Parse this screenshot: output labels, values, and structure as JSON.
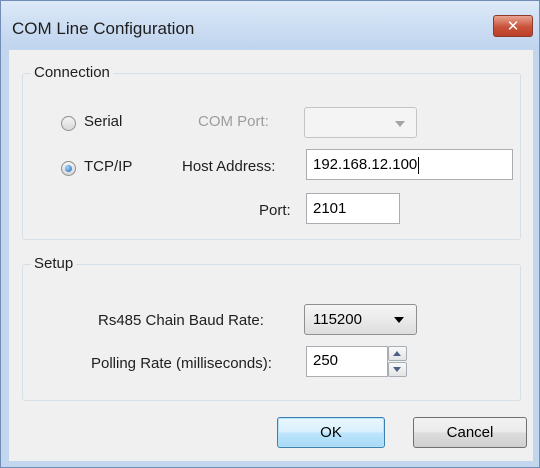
{
  "window": {
    "title": "COM Line Configuration",
    "close_glyph": "✕"
  },
  "connection": {
    "group_label": "Connection",
    "serial_label": "Serial",
    "tcpip_label": "TCP/IP",
    "selected": "TCP/IP",
    "com_port_label": "COM Port:",
    "com_port_value": "",
    "host_address_label": "Host Address:",
    "host_address_value": "192.168.12.100",
    "port_label": "Port:",
    "port_value": "2101"
  },
  "setup": {
    "group_label": "Setup",
    "baud_rate_label": "Rs485 Chain Baud Rate:",
    "baud_rate_value": "115200",
    "polling_rate_label": "Polling Rate (milliseconds):",
    "polling_rate_value": "250"
  },
  "buttons": {
    "ok_label": "OK",
    "cancel_label": "Cancel"
  },
  "colors": {
    "title_bar": "#c2d7ee",
    "close_button": "#c9523a",
    "dialog_background": "#f0f0f0",
    "default_button": "#bee6fd"
  },
  "icons": {
    "close": "close-icon",
    "radio_selected": "radio-selected-icon",
    "radio_unselected": "radio-unselected-icon",
    "dropdown": "chevron-down-icon",
    "spin_up": "spin-up-icon",
    "spin_down": "spin-down-icon"
  }
}
